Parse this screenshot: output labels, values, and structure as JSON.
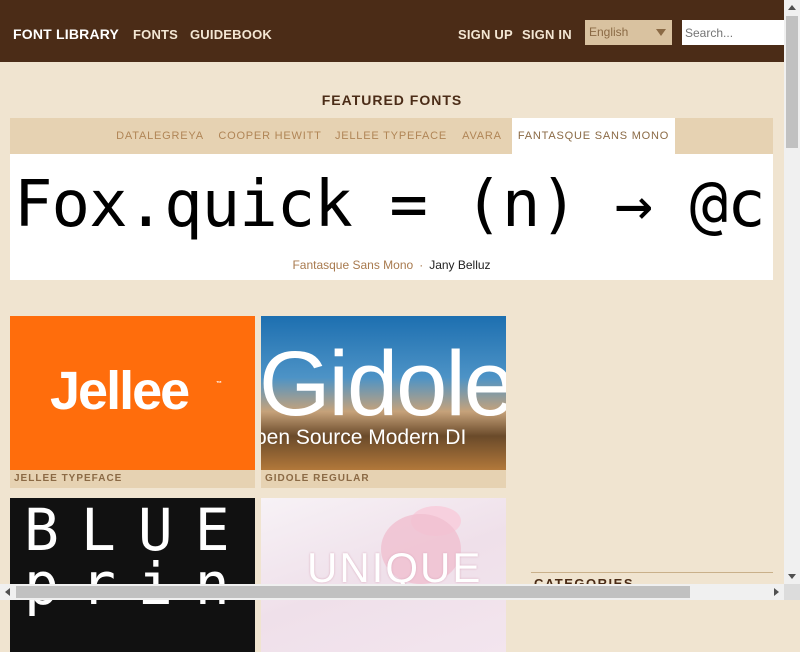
{
  "header": {
    "brand": "FONT LIBRARY",
    "nav": [
      "FONTS",
      "GUIDEBOOK"
    ],
    "signup": "SIGN UP",
    "signin": "SIGN IN",
    "language": "English",
    "search_placeholder": "Search..."
  },
  "featured": {
    "title": "FEATURED FONTS",
    "tabs": [
      "DATALEGREYA",
      "COOPER HEWITT",
      "JELLEE TYPEFACE",
      "AVARA",
      "FANTASQUE SANS MONO"
    ],
    "active_tab": "FANTASQUE SANS MONO",
    "sample_text": "Fox.quick = (n) → @c",
    "font_name": "Fantasque Sans Mono",
    "separator": "·",
    "author": "Jany Belluz"
  },
  "cards": [
    {
      "label": "JELLEE TYPEFACE",
      "image_text": "Jellee",
      "image_mark": "™"
    },
    {
      "label": "GIDOLE REGULAR",
      "image_text": "Gidole",
      "image_subtext": "pen Source Modern DI"
    },
    {
      "label": "",
      "image_text": "BLUE",
      "image_text2": "print"
    },
    {
      "label": "",
      "image_text": "UNIQUE"
    }
  ],
  "sidebar": {
    "heading": "CATEGORIES"
  },
  "colors": {
    "header_bg": "#4b2c17",
    "page_bg": "#f0e4d0",
    "tab_bg": "#e6d2b2",
    "accent": "#a87a4e",
    "jellee_orange": "#ff6d0c"
  }
}
